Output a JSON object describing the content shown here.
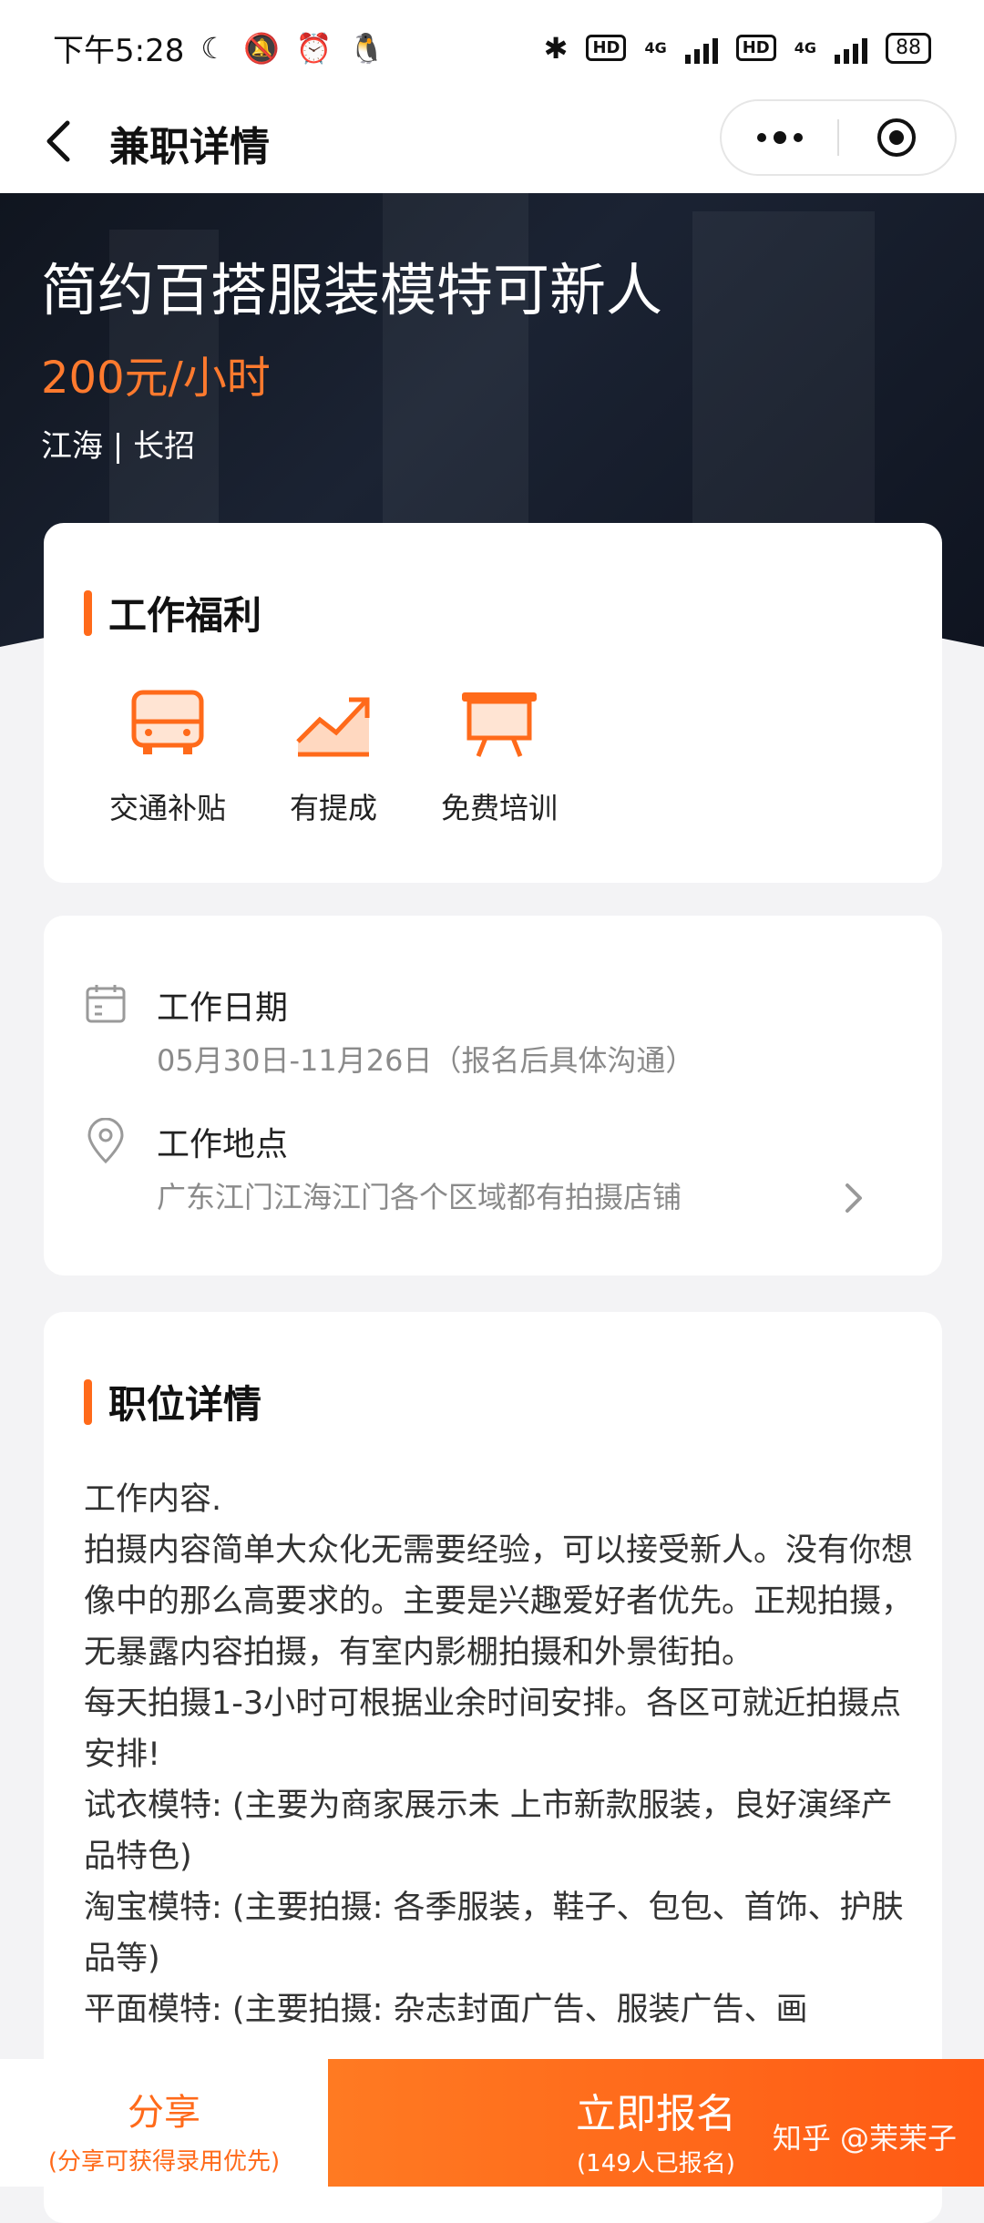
{
  "status_bar": {
    "time": "下午5:28",
    "network_label_1": "4G",
    "network_label_2": "4G",
    "hd_label_1": "HD",
    "hd_label_2": "HD",
    "battery": "88"
  },
  "nav": {
    "title": "兼职详情"
  },
  "hero": {
    "job_title": "简约百搭服装模特可新人",
    "salary": "200元/小时",
    "meta": "江海 | 长招"
  },
  "benefits": {
    "title": "工作福利",
    "items": [
      {
        "label": "交通补贴",
        "icon": "bus-icon"
      },
      {
        "label": "有提成",
        "icon": "trend-up-icon"
      },
      {
        "label": "免费培训",
        "icon": "training-board-icon"
      }
    ]
  },
  "work_info": {
    "date_title": "工作日期",
    "date_value": "05月30日-11月26日（报名后具体沟通）",
    "location_title": "工作地点",
    "location_value": "广东江门江海江门各个区域都有拍摄店铺"
  },
  "details": {
    "title": "职位详情",
    "lines": [
      "工作内容.",
      "拍摄内容简单大众化无需要经验，可以接受新人。没有你想像中的那么高要求的。主要是兴趣爱好者优先。正规拍摄，无暴露内容拍摄，有室内影棚拍摄和外景街拍。",
      "每天拍摄1-3小时可根据业余时间安排。各区可就近拍摄点安排!",
      "试衣模特: (主要为商家展示未 上市新款服装，良好演绎产品特色)",
      "淘宝模特: (主要拍摄: 各季服装，鞋子、包包、首饰、护肤品等)",
      "平面模特: (主要拍摄: 杂志封面广告、服装广告、画"
    ]
  },
  "bottom": {
    "share_label": "分享",
    "share_sub": "(分享可获得录用优先)",
    "apply_label": "立即报名",
    "apply_sub": "(149人已报名)",
    "watermark": "知乎 @茉茉子"
  },
  "colors": {
    "accent": "#ff6a1a",
    "salary": "#ff7a2e"
  }
}
